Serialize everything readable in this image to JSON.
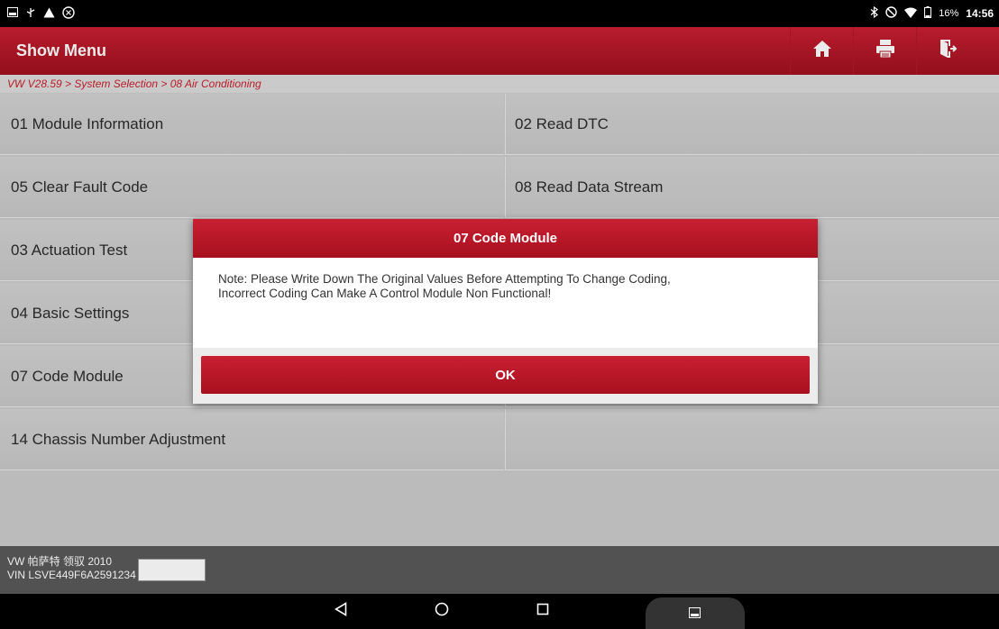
{
  "status_bar": {
    "left_icons": [
      "gallery-icon",
      "usb-icon",
      "warning-icon",
      "android-debug-icon"
    ],
    "right_icons": [
      "bluetooth-icon",
      "do-not-disturb-icon",
      "wifi-icon",
      "battery-icon"
    ],
    "battery": "16%",
    "time": "14:56"
  },
  "header": {
    "title": "Show Menu",
    "buttons": [
      "home-icon",
      "print-icon",
      "exit-icon"
    ]
  },
  "breadcrumb": "VW V28.59 > System Selection > 08 Air Conditioning",
  "menu": {
    "items": [
      {
        "label": "01 Module Information"
      },
      {
        "label": "02 Read DTC"
      },
      {
        "label": "05 Clear Fault Code"
      },
      {
        "label": "08 Read Data Stream"
      },
      {
        "label": "03 Actuation Test"
      },
      {
        "label": ""
      },
      {
        "label": "04 Basic Settings"
      },
      {
        "label": ""
      },
      {
        "label": "07 Code Module"
      },
      {
        "label": ""
      },
      {
        "label": "14 Chassis Number Adjustment"
      },
      {
        "label": ""
      }
    ]
  },
  "footer": {
    "vehicle": "VW 帕萨特 领驭 2010",
    "vin": "VIN LSVE449F6A2591234"
  },
  "dialog": {
    "title": "07 Code Module",
    "message": "Note: Please Write Down The Original Values Before Attempting To Change Coding,\n Incorrect Coding Can Make A Control Module Non Functional!",
    "ok_label": "OK"
  },
  "colors": {
    "accent_red": "#c01a2b",
    "breadcrumb_red": "#c8202d",
    "menu_bg": "#cbcbcb",
    "footer_bg": "#5a5a5a"
  }
}
